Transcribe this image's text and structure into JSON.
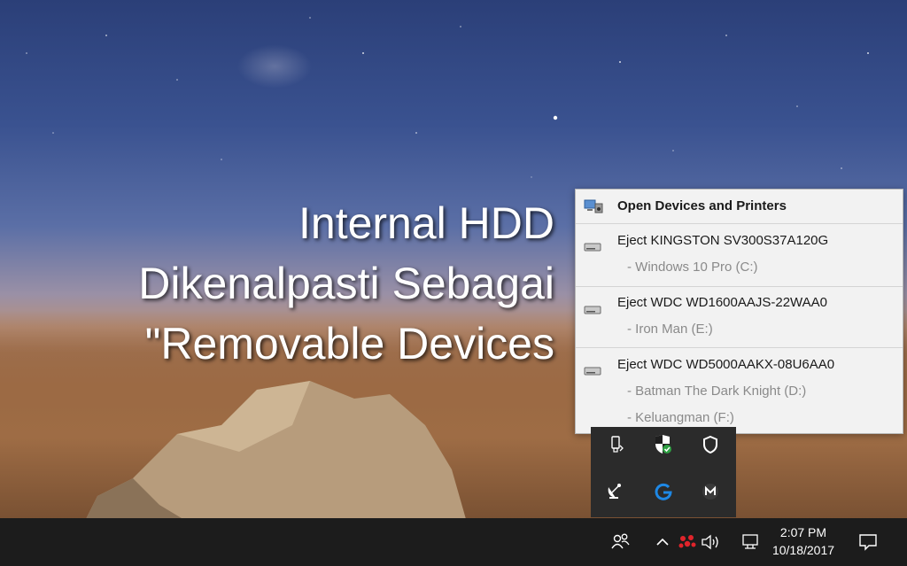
{
  "caption": {
    "line1": "Internal HDD",
    "line2": "Dikenalpasti Sebagai",
    "line3": "\"Removable Devices"
  },
  "flyout": {
    "open_devices": "Open Devices and Printers",
    "drives": [
      {
        "eject_label": "Eject KINGSTON SV300S37A120G",
        "volumes": [
          "-   Windows 10 Pro (C:)"
        ]
      },
      {
        "eject_label": "Eject WDC WD1600AAJS-22WAA0",
        "volumes": [
          "-   Iron Man (E:)"
        ]
      },
      {
        "eject_label": "Eject WDC WD5000AAKX-08U6AA0",
        "volumes": [
          "-   Batman The Dark Knight (D:)",
          "-   Keluangman (F:)"
        ]
      }
    ]
  },
  "tray_overflow": {
    "icons": [
      "usb-safely-remove-icon",
      "windows-defender-icon",
      "shield-outline-icon",
      "satellite-dish-icon",
      "logitech-g-icon",
      "malwarebytes-icon"
    ]
  },
  "taskbar": {
    "icons": [
      "people-icon",
      "chevron-up-icon",
      "network-app-icon",
      "volume-icon",
      "network-icon",
      "action-center-icon"
    ],
    "time": "2:07 PM",
    "date": "10/18/2017"
  },
  "colors": {
    "taskbar_bg": "#1c1c1c",
    "flyout_bg": "#f2f2f2",
    "defender_green": "#2ea043",
    "logitech_blue": "#1e88e5"
  }
}
